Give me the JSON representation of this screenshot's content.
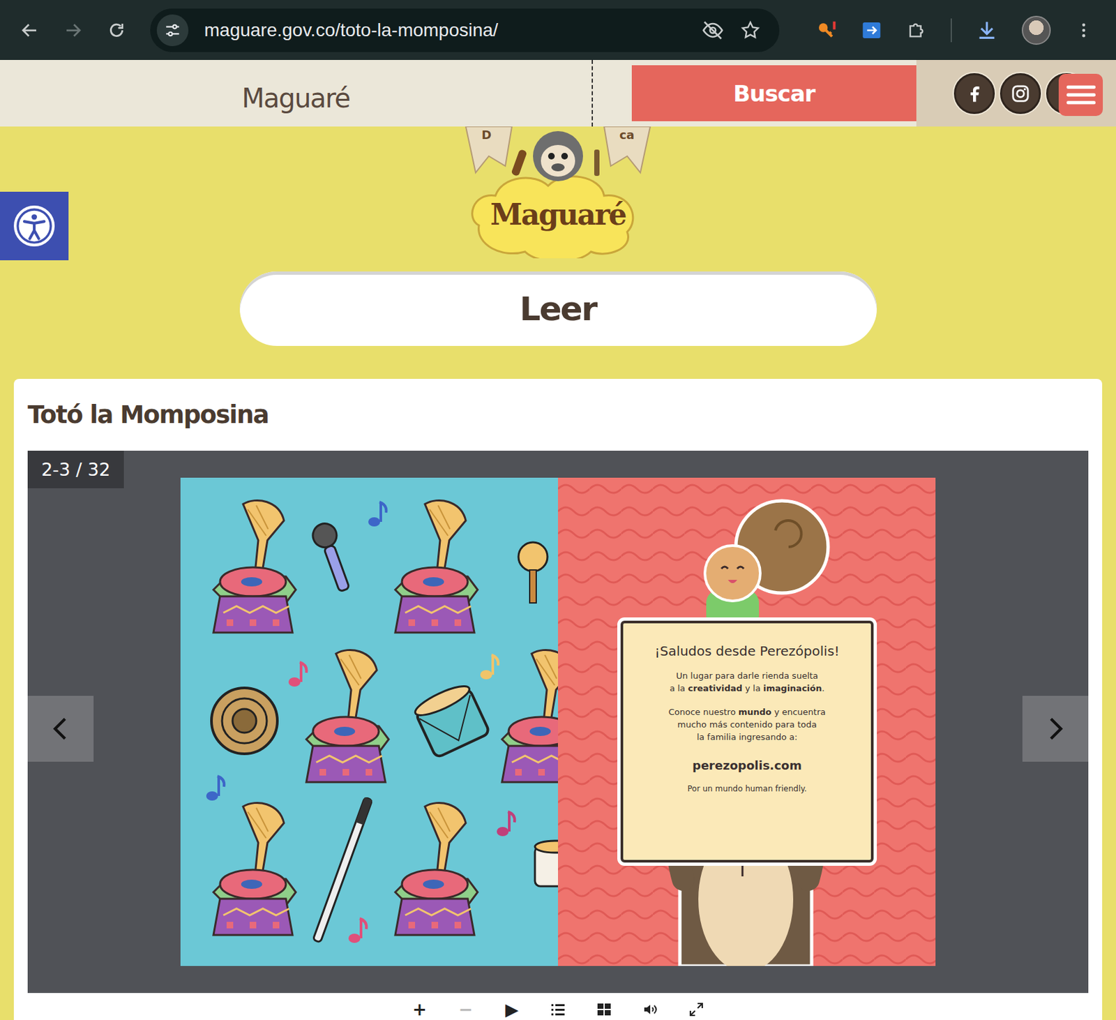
{
  "browser": {
    "url": "maguare.gov.co/toto-la-momposina/"
  },
  "site_header": {
    "brand": "Maguaré",
    "search_button": "Buscar",
    "social": [
      {
        "kind": "facebook"
      },
      {
        "kind": "instagram"
      },
      {
        "kind": "youtube"
      }
    ]
  },
  "logo": {
    "text": "Maguaré",
    "banners": [
      "D",
      "ca"
    ]
  },
  "section_title": "Leer",
  "book": {
    "title": "Totó la Momposina",
    "page_counter": "2-3 / 32",
    "note": {
      "title": "¡Saludos desde Perezópolis!",
      "paragraphs": [
        [
          [
            {
              "text": "Un lugar para darle rienda suelta",
              "bold": false
            }
          ],
          [
            {
              "text": "a la ",
              "bold": false
            },
            {
              "text": "creatividad",
              "bold": true
            },
            {
              "text": " y la ",
              "bold": false
            },
            {
              "text": "imaginación",
              "bold": true
            },
            {
              "text": ".",
              "bold": false
            }
          ]
        ],
        [
          [
            {
              "text": "Conoce nuestro ",
              "bold": false
            },
            {
              "text": "mundo",
              "bold": true
            },
            {
              "text": " y encuentra",
              "bold": false
            }
          ],
          [
            {
              "text": "mucho más contenido para toda",
              "bold": false
            }
          ],
          [
            {
              "text": "la familia ingresando a:",
              "bold": false
            }
          ]
        ]
      ],
      "link": "perezopolis.com",
      "footer": "Por un mundo human friendly."
    }
  },
  "viewer_toolbar": [
    {
      "kind": "zoom-in",
      "glyph": "+",
      "disabled": false
    },
    {
      "kind": "zoom-out",
      "glyph": "−",
      "disabled": true
    },
    {
      "kind": "play",
      "glyph": "▶",
      "disabled": false
    },
    {
      "kind": "toc",
      "glyph": "",
      "disabled": false
    },
    {
      "kind": "thumbnails",
      "glyph": "",
      "disabled": false
    },
    {
      "kind": "sound",
      "glyph": "",
      "disabled": false
    },
    {
      "kind": "fullscreen",
      "glyph": "",
      "disabled": false
    }
  ]
}
